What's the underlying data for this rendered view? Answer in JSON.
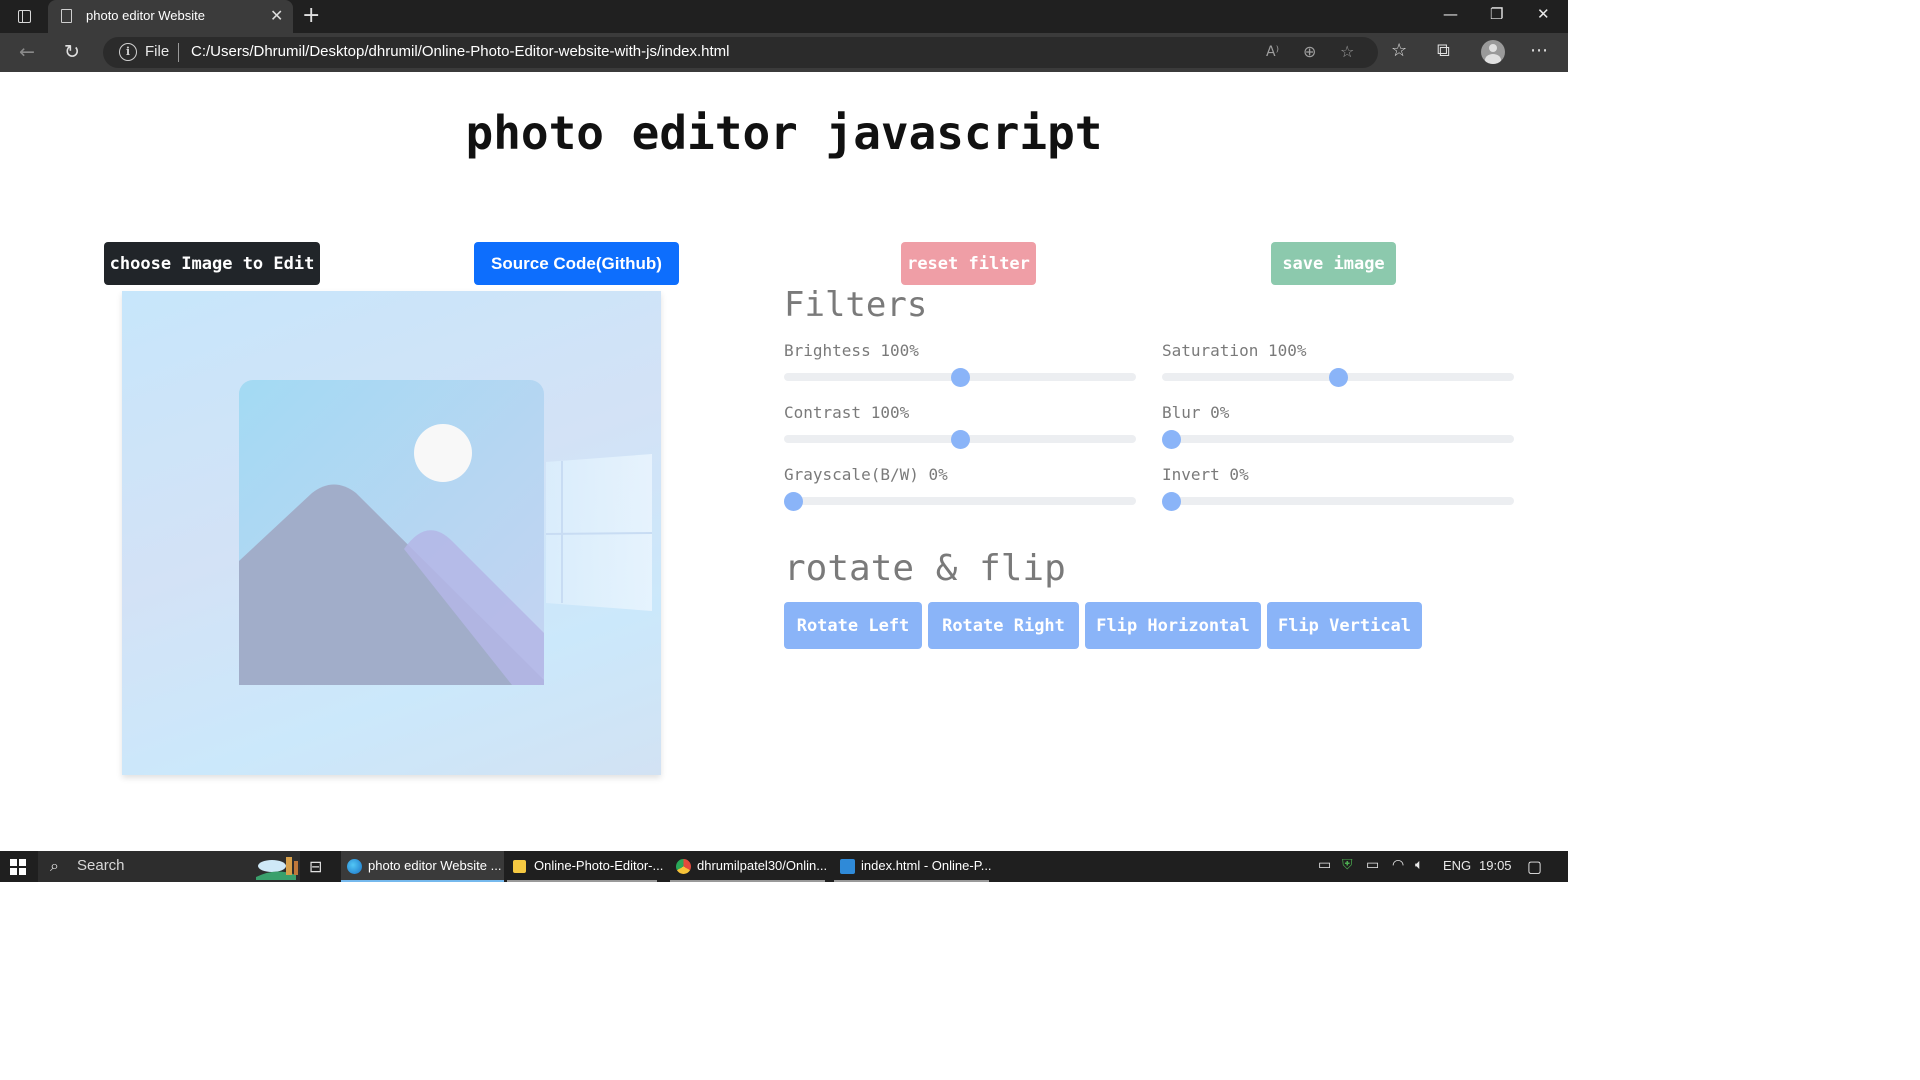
{
  "browser": {
    "tab_title": "photo editor Website",
    "address_scheme": "File",
    "url": "C:/Users/Dhrumil/Desktop/dhrumil/Online-Photo-Editor-website-with-js/index.html"
  },
  "page": {
    "title": "photo editor javascript",
    "buttons": {
      "choose": "choose Image to Edit",
      "source": "Source Code(Github)",
      "reset": "reset filter",
      "save": "save image"
    },
    "filters_title": "Filters",
    "sliders": [
      {
        "label": "Brightess 100%",
        "value": 100,
        "max": 200
      },
      {
        "label": "Saturation 100%",
        "value": 100,
        "max": 200
      },
      {
        "label": "Contrast 100%",
        "value": 100,
        "max": 200
      },
      {
        "label": "Blur 0%",
        "value": 0,
        "max": 100
      },
      {
        "label": "Grayscale(B/W) 0%",
        "value": 0,
        "max": 100
      },
      {
        "label": "Invert 0%",
        "value": 0,
        "max": 100
      }
    ],
    "rotate_title": "rotate & flip",
    "rotate_buttons": [
      "Rotate Left",
      "Rotate Right",
      "Flip Horizontal",
      "Flip Vertical"
    ]
  },
  "taskbar": {
    "search": "Search",
    "items": [
      {
        "label": "photo editor Website ...",
        "icon": "edge-icon",
        "active": true
      },
      {
        "label": "Online-Photo-Editor-...",
        "icon": "folder-icon",
        "active": false
      },
      {
        "label": "dhrumilpatel30/Onlin...",
        "icon": "chrome-icon",
        "active": false
      },
      {
        "label": "index.html - Online-P...",
        "icon": "vscode-icon",
        "active": false
      }
    ],
    "language": "ENG",
    "time": "19:05"
  },
  "colors": {
    "accent": "#8ab4f8",
    "dark_button": "#212529",
    "primary_button": "#0d6efd",
    "reset_button": "#ef9ea6",
    "save_button": "#8cc9ad"
  }
}
